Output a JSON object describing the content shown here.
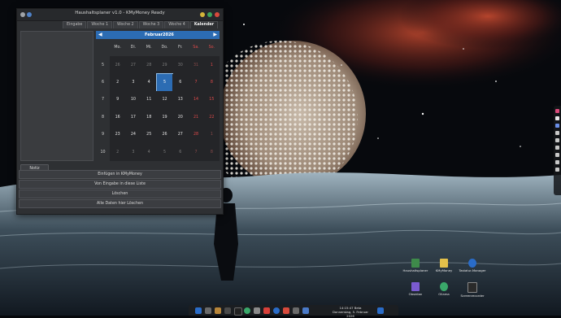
{
  "window": {
    "title": "Haushaltsplaner v1.0 - KMyMoney Ready",
    "tabs": [
      {
        "label": "Eingabe"
      },
      {
        "label": "Woche 1"
      },
      {
        "label": "Woche 2"
      },
      {
        "label": "Woche 3"
      },
      {
        "label": "Woche 4"
      },
      {
        "label": "Kalender",
        "active": true
      }
    ],
    "notiz_button": "Notiz Speichern",
    "actions": [
      "Einfügen in KMyMoney",
      "Von Eingabe in diese Liste",
      "Löschen",
      "Alle Daten hier Löschen"
    ]
  },
  "calendar": {
    "prev_icon": "arrow-left-icon",
    "next_icon": "arrow-right-icon",
    "month": "Februar",
    "year": "2026",
    "weekdays": [
      "Mo.",
      "Di.",
      "Mi.",
      "Do.",
      "Fr.",
      "Sa.",
      "So."
    ],
    "weeks": [
      {
        "wk": "5",
        "days": [
          "26",
          "27",
          "28",
          "29",
          "30",
          "31",
          "1"
        ]
      },
      {
        "wk": "6",
        "days": [
          "2",
          "3",
          "4",
          "5",
          "6",
          "7",
          "8"
        ]
      },
      {
        "wk": "7",
        "days": [
          "9",
          "10",
          "11",
          "12",
          "13",
          "14",
          "15"
        ]
      },
      {
        "wk": "8",
        "days": [
          "16",
          "17",
          "18",
          "19",
          "20",
          "21",
          "22"
        ]
      },
      {
        "wk": "9",
        "days": [
          "23",
          "24",
          "25",
          "26",
          "27",
          "28",
          "1"
        ]
      },
      {
        "wk": "10",
        "days": [
          "2",
          "3",
          "4",
          "5",
          "6",
          "7",
          "8"
        ]
      }
    ],
    "selected_day": "5",
    "colors": {
      "accent": "#2c6cb3",
      "weekend": "#e04a4a"
    }
  },
  "desktop_icons": [
    {
      "label": "Haushaltsplaner",
      "icon": "spreadsheet-icon",
      "color": "#3e8a4a"
    },
    {
      "label": "KMyMoney",
      "icon": "kmymoney-icon",
      "color": "#e3c04a"
    },
    {
      "label": "Tastatur-Manager",
      "icon": "keyboard-manager-icon",
      "color": "#2a6cc8"
    },
    {
      "label": "Obsidian",
      "icon": "obsidian-icon",
      "color": "#7a5bd0"
    },
    {
      "label": "Ollama",
      "icon": "ollama-icon",
      "color": "#3aa86a"
    },
    {
      "label": "Screenrecorder",
      "icon": "screenrecorder-icon",
      "color": "#2a2a2a"
    }
  ],
  "taskbar": {
    "icons": [
      "finder-icon",
      "launchpad-icon",
      "archive-icon",
      "files-icon",
      "terminal-icon",
      "chrome-icon",
      "text-editor-icon",
      "vivaldi-icon",
      "thunderbird-icon",
      "screenshot-icon",
      "music-icon",
      "settings-icon"
    ],
    "clock_time": "14:15:47 ",
    "clock_suffix": "Beta",
    "clock_date": "Donnerstag, 5. Februar 2026"
  }
}
